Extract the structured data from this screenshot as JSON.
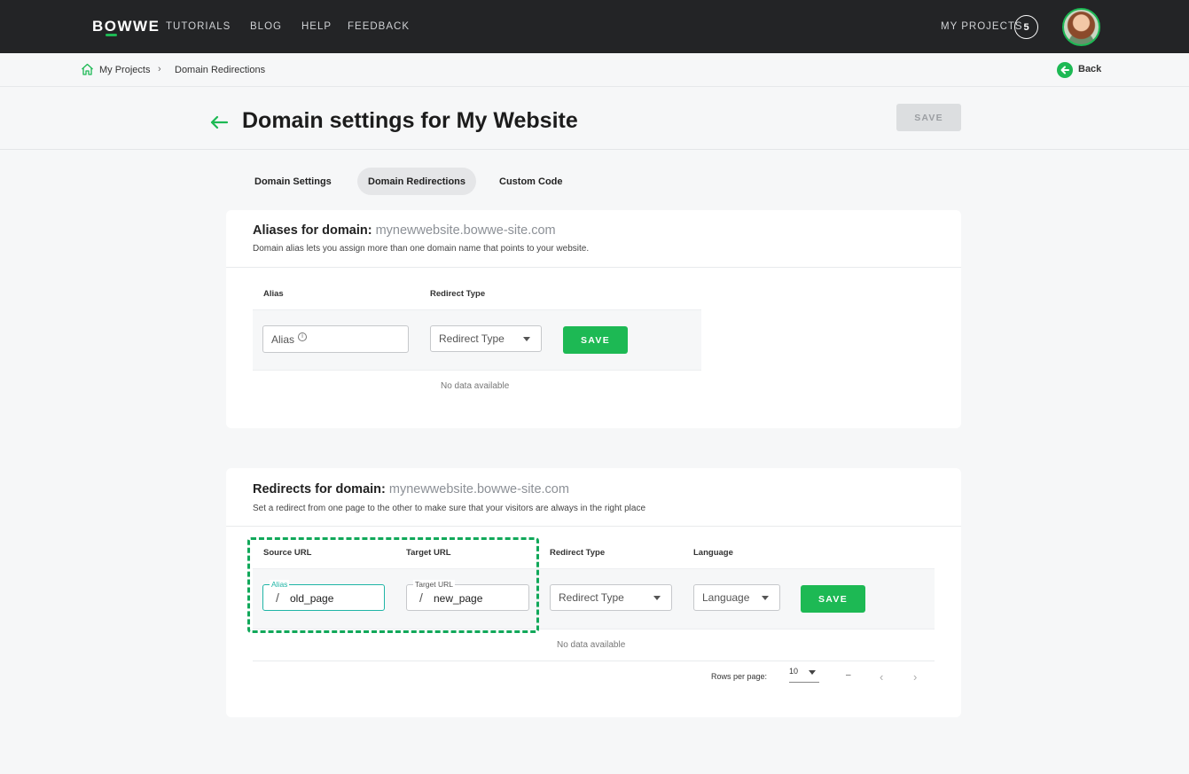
{
  "nav": {
    "logo": "BOWWE",
    "links": [
      "TUTORIALS",
      "BLOG",
      "HELP",
      "FEEDBACK"
    ],
    "my_projects_label": "MY PROJECTS",
    "project_count": "5"
  },
  "breadcrumb": {
    "items": [
      "My Projects",
      "Domain Redirections"
    ],
    "separator": "›",
    "back_label": "Back"
  },
  "header": {
    "title": "Domain settings for My Website",
    "save_label": "SAVE"
  },
  "tabs": [
    {
      "label": "Domain Settings",
      "active": false
    },
    {
      "label": "Domain Redirections",
      "active": true
    },
    {
      "label": "Custom Code",
      "active": false
    }
  ],
  "aliases": {
    "title": "Aliases for domain:",
    "domain": "mynewwebsite.bowwe-site.com",
    "subtitle": "Domain alias lets you assign more than one domain name that points to your website.",
    "columns": [
      "Alias",
      "Redirect Type"
    ],
    "alias_placeholder": "Alias",
    "redirect_type_value": "Redirect Type",
    "save_label": "SAVE",
    "empty_text": "No data available"
  },
  "redirects": {
    "title": "Redirects for domain:",
    "domain": "mynewwebsite.bowwe-site.com",
    "subtitle": "Set a redirect from one page to the other to make sure that your visitors are always in the right place",
    "columns": [
      "Source URL",
      "Target URL",
      "Redirect Type",
      "Language"
    ],
    "source_legend": "Alias",
    "source_slash": "/",
    "source_value": "old_page",
    "target_legend": "Target URL",
    "target_slash": "/",
    "target_value": "new_page",
    "redirect_type_value": "Redirect Type",
    "language_value": "Language",
    "save_label": "SAVE",
    "empty_text": "No data available",
    "pagination": {
      "rows_per_page_label": "Rows per page:",
      "rows_per_page_value": "10",
      "range_text": "–",
      "prev": "‹",
      "next": "›"
    }
  },
  "colors": {
    "accent": "#1db954",
    "topbar": "#232426",
    "highlight_dash": "#11a85a"
  }
}
